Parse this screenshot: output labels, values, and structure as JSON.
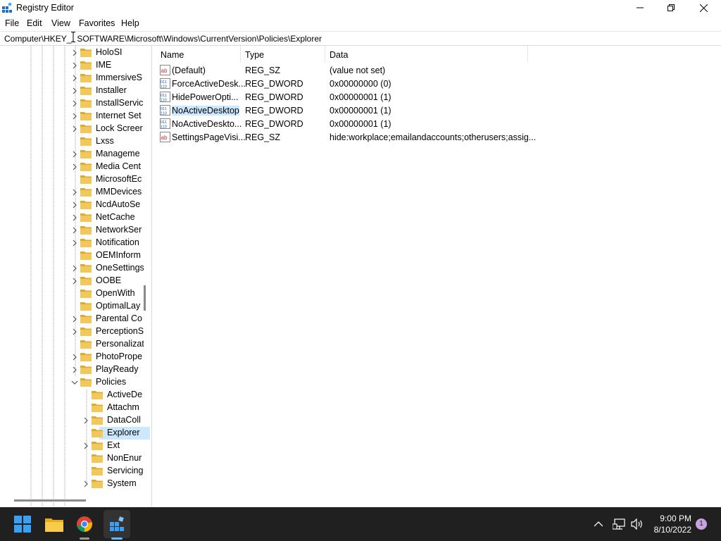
{
  "window": {
    "title": "Registry Editor",
    "controls": [
      "minimize",
      "maximize",
      "close"
    ]
  },
  "menu": [
    "File",
    "Edit",
    "View",
    "Favorites",
    "Help"
  ],
  "address": "Computer\\HKEY_LOCAL_MACHINE\\SOFTWARE\\Microsoft\\Windows\\CurrentVersion\\Policies\\Explorer",
  "address_visible": "Computer\\HKEY_",
  "address_visible_rest": "SOFTWARE\\Microsoft\\Windows\\CurrentVersion\\Policies\\Explorer",
  "tree": {
    "items": [
      {
        "label": "HoloSI",
        "level": 0,
        "expander": "collapsed"
      },
      {
        "label": "IME",
        "level": 0,
        "expander": "collapsed"
      },
      {
        "label": "ImmersiveS",
        "level": 0,
        "expander": "collapsed"
      },
      {
        "label": "Installer",
        "level": 0,
        "expander": "collapsed"
      },
      {
        "label": "InstallServic",
        "level": 0,
        "expander": "collapsed"
      },
      {
        "label": "Internet Set",
        "level": 0,
        "expander": "collapsed"
      },
      {
        "label": "Lock Screer",
        "level": 0,
        "expander": "collapsed"
      },
      {
        "label": "Lxss",
        "level": 0,
        "expander": "none"
      },
      {
        "label": "Manageme",
        "level": 0,
        "expander": "collapsed"
      },
      {
        "label": "Media Cent",
        "level": 0,
        "expander": "collapsed"
      },
      {
        "label": "MicrosoftEc",
        "level": 0,
        "expander": "none"
      },
      {
        "label": "MMDevices",
        "level": 0,
        "expander": "collapsed"
      },
      {
        "label": "NcdAutoSe",
        "level": 0,
        "expander": "collapsed"
      },
      {
        "label": "NetCache",
        "level": 0,
        "expander": "collapsed"
      },
      {
        "label": "NetworkSer",
        "level": 0,
        "expander": "collapsed"
      },
      {
        "label": "Notification",
        "level": 0,
        "expander": "collapsed"
      },
      {
        "label": "OEMInform",
        "level": 0,
        "expander": "none"
      },
      {
        "label": "OneSettings",
        "level": 0,
        "expander": "collapsed"
      },
      {
        "label": "OOBE",
        "level": 0,
        "expander": "collapsed"
      },
      {
        "label": "OpenWith",
        "level": 0,
        "expander": "none"
      },
      {
        "label": "OptimalLay",
        "level": 0,
        "expander": "none"
      },
      {
        "label": "Parental Co",
        "level": 0,
        "expander": "collapsed"
      },
      {
        "label": "PerceptionS",
        "level": 0,
        "expander": "collapsed"
      },
      {
        "label": "Personalizat",
        "level": 0,
        "expander": "none"
      },
      {
        "label": "PhotoPrope",
        "level": 0,
        "expander": "collapsed"
      },
      {
        "label": "PlayReady",
        "level": 0,
        "expander": "collapsed"
      },
      {
        "label": "Policies",
        "level": 0,
        "expander": "expanded"
      },
      {
        "label": "ActiveDe",
        "level": 1,
        "expander": "none"
      },
      {
        "label": "Attachm",
        "level": 1,
        "expander": "none"
      },
      {
        "label": "DataColl",
        "level": 1,
        "expander": "collapsed"
      },
      {
        "label": "Explorer",
        "level": 1,
        "expander": "none",
        "selected": true
      },
      {
        "label": "Ext",
        "level": 1,
        "expander": "collapsed"
      },
      {
        "label": "NonEnur",
        "level": 1,
        "expander": "none"
      },
      {
        "label": "Servicing",
        "level": 1,
        "expander": "none"
      },
      {
        "label": "System",
        "level": 1,
        "expander": "collapsed"
      }
    ]
  },
  "list": {
    "columns": [
      "Name",
      "Type",
      "Data"
    ],
    "rows": [
      {
        "icon": "string-value-icon",
        "name": "(Default)",
        "type": "REG_SZ",
        "data": "(value not set)"
      },
      {
        "icon": "dword-value-icon",
        "name": "ForceActiveDesk...",
        "type": "REG_DWORD",
        "data": "0x00000000 (0)"
      },
      {
        "icon": "dword-value-icon",
        "name": "HidePowerOpti...",
        "type": "REG_DWORD",
        "data": "0x00000001 (1)"
      },
      {
        "icon": "dword-value-icon",
        "name": "NoActiveDesktop",
        "type": "REG_DWORD",
        "data": "0x00000001 (1)"
      },
      {
        "icon": "dword-value-icon",
        "name": "NoActiveDeskto...",
        "type": "REG_DWORD",
        "data": "0x00000001 (1)"
      },
      {
        "icon": "string-value-icon",
        "name": "SettingsPageVisi...",
        "type": "REG_SZ",
        "data": "hide:workplace;emailandaccounts;otherusers;assig..."
      }
    ]
  },
  "taskbar": {
    "apps": [
      "start-icon",
      "file-explorer-icon",
      "chrome-icon",
      "registry-editor-icon"
    ],
    "time": "9:00 PM",
    "date": "8/10/2022",
    "notification_count": "1"
  },
  "colors": {
    "selection": "#cce8ff",
    "folder": "#f2c75c",
    "taskbar": "#202020",
    "accent": "#0078d4"
  }
}
